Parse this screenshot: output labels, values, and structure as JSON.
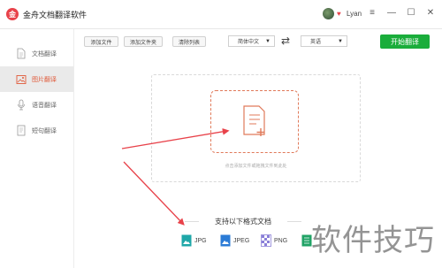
{
  "app": {
    "logo_char": "金",
    "title": "金舟文档翻译软件"
  },
  "user": {
    "name": "Lyan"
  },
  "window_controls": {
    "menu": "≡",
    "minimize": "—",
    "maximize": "☐",
    "close": "✕"
  },
  "sidebar": {
    "items": [
      {
        "label": "文档翻译",
        "icon": "document-icon",
        "active": false
      },
      {
        "label": "图片翻译",
        "icon": "image-icon",
        "active": true
      },
      {
        "label": "语音翻译",
        "icon": "microphone-icon",
        "active": false
      },
      {
        "label": "短句翻译",
        "icon": "note-icon",
        "active": false
      }
    ]
  },
  "toolbar": {
    "add_file": "添加文件",
    "add_folder": "添加文件夹",
    "clear_list": "清除列表",
    "source_lang": "简体中文",
    "target_lang": "英语",
    "swap": "⇄",
    "start": "开始翻译"
  },
  "dropzone": {
    "hint": "点击添加文件或拖拽文件到此处"
  },
  "formats": {
    "title": "支持以下格式文档",
    "items": [
      "JPG",
      "JPEG",
      "PNG"
    ]
  },
  "watermark": "软件技巧",
  "colors": {
    "accent": "#e05a3a",
    "start_button": "#1aad3b",
    "arrow": "#e8424a"
  }
}
